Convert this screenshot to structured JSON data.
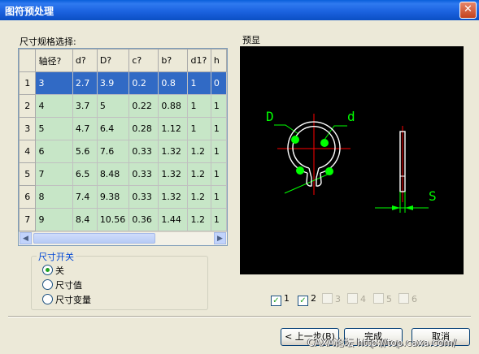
{
  "window": {
    "title": "图符预处理",
    "close_glyph": "✕"
  },
  "table_section": {
    "label": "尺寸规格选择:",
    "columns": [
      "轴径?",
      "d?",
      "D?",
      "c?",
      "b?",
      "d1?",
      "h"
    ],
    "rows": [
      {
        "index": "1",
        "cells": [
          "3",
          "2.7",
          "3.9",
          "0.2",
          "0.8",
          "1",
          "0"
        ],
        "selected": true
      },
      {
        "index": "2",
        "cells": [
          "4",
          "3.7",
          "5",
          "0.22",
          "0.88",
          "1",
          "1"
        ]
      },
      {
        "index": "3",
        "cells": [
          "5",
          "4.7",
          "6.4",
          "0.28",
          "1.12",
          "1",
          "1"
        ]
      },
      {
        "index": "4",
        "cells": [
          "6",
          "5.6",
          "7.6",
          "0.33",
          "1.32",
          "1.2",
          "1"
        ]
      },
      {
        "index": "5",
        "cells": [
          "7",
          "6.5",
          "8.48",
          "0.33",
          "1.32",
          "1.2",
          "1"
        ]
      },
      {
        "index": "6",
        "cells": [
          "8",
          "7.4",
          "9.38",
          "0.33",
          "1.32",
          "1.2",
          "1"
        ]
      },
      {
        "index": "7",
        "cells": [
          "9",
          "8.4",
          "10.56",
          "0.36",
          "1.44",
          "1.2",
          "1"
        ]
      }
    ],
    "scroll_left": "◀",
    "scroll_right": "▶"
  },
  "dimension_switch": {
    "title": "尺寸开关",
    "options": [
      {
        "label": "关",
        "selected": true
      },
      {
        "label": "尺寸值",
        "selected": false
      },
      {
        "label": "尺寸变量",
        "selected": false
      }
    ]
  },
  "preview": {
    "label": "预显",
    "dim_labels": {
      "outer": "D",
      "inner": "d",
      "thickness": "S"
    },
    "colors": {
      "background": "#000000",
      "outline": "#ffffff",
      "dimension": "#00ff00",
      "centerline": "#ff0000"
    }
  },
  "view_checkboxes": [
    {
      "label": "1",
      "checked": true,
      "enabled": true
    },
    {
      "label": "2",
      "checked": true,
      "enabled": true
    },
    {
      "label": "3",
      "checked": false,
      "enabled": false
    },
    {
      "label": "4",
      "checked": false,
      "enabled": false
    },
    {
      "label": "5",
      "checked": false,
      "enabled": false
    },
    {
      "label": "6",
      "checked": false,
      "enabled": false
    }
  ],
  "buttons": {
    "prev": "< 上一步(B)",
    "finish": "完成",
    "cancel": "取消"
  },
  "watermark": "CAXA论坛 http://top.caxa.com/"
}
